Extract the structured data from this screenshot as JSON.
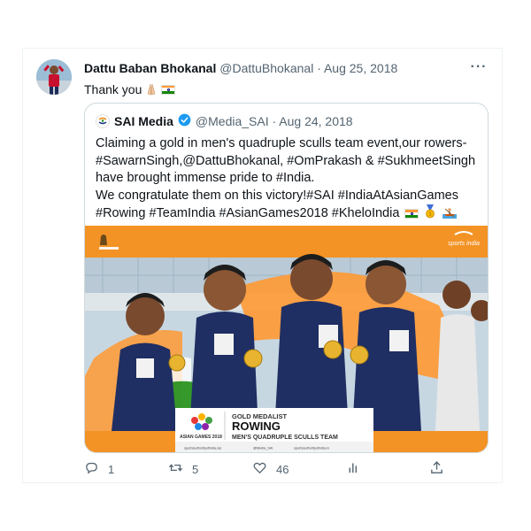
{
  "tweet": {
    "author_name": "Dattu Baban Bhokanal",
    "author_meta": "@DattuBhokanal · Aug 25, 2018",
    "more_label": "···",
    "text": "Thank you",
    "emojis": [
      "folded-hands",
      "flag-india"
    ]
  },
  "quoted": {
    "author_name": "SAI Media",
    "author_meta": "@Media_SAI · Aug 24, 2018",
    "lines": [
      "Claiming a gold in men's quadruple sculls team event,our rowers-",
      "#SawarnSingh,@DattuBhokanal, #OmPrakash & #SukhmeetSingh",
      "have brought immense pride to #India.",
      "We congratulate them on this victory!#SAI #IndiaAtAsianGames",
      "#Rowing #TeamIndia #AsianGames2018 #KheloIndia"
    ],
    "trailing_emojis": [
      "flag-india",
      "gold-medal",
      "rowing"
    ],
    "image": {
      "brand_color": "#f39325",
      "banner_line1": "GOLD MEDALIST",
      "banner_line2": "ROWING",
      "banner_line3": "MEN'S QUADRUPLE SCULLS TEAM",
      "event_label": "ASIAN GAMES 2018",
      "top_right_label": "sports india",
      "footer_items": [
        "sportsauthorityofindia.sai",
        "@Media_SAI",
        "sportsauthorityofindia.in"
      ]
    }
  },
  "actions": {
    "reply_count": "1",
    "retweet_count": "5",
    "like_count": "46",
    "views_icon": "bar-chart-icon",
    "share_icon": "share-icon"
  },
  "colors": {
    "text_primary": "#0f1419",
    "text_secondary": "#536471",
    "verified": "#1d9bf0",
    "border": "#cfd9de"
  }
}
